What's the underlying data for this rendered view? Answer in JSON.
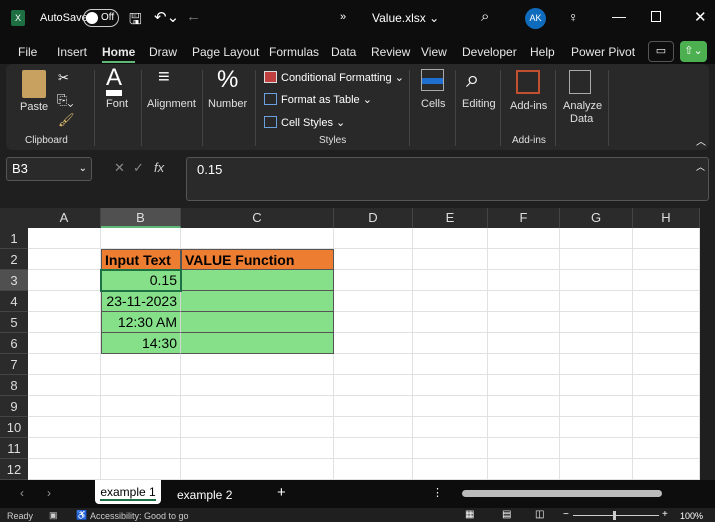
{
  "titlebar": {
    "autosave": "AutoSave",
    "toggle": "Off",
    "filename": "Value.xlsx ⌄",
    "avatar": "AK"
  },
  "menu": [
    "File",
    "Insert",
    "Home",
    "Draw",
    "Page Layout",
    "Formulas",
    "Data",
    "Review",
    "View",
    "Developer",
    "Help",
    "Power Pivot"
  ],
  "ribbon": {
    "paste": "Paste",
    "clipboard": "Clipboard",
    "font": "Font",
    "alignment": "Alignment",
    "number": "Number",
    "cond_format": "Conditional Formatting ⌄",
    "format_table": "Format as Table ⌄",
    "cell_styles": "Cell Styles ⌄",
    "styles": "Styles",
    "cells": "Cells",
    "editing": "Editing",
    "addins": "Add-ins",
    "addins_group": "Add-ins",
    "analyze": "Analyze",
    "analyze2": "Data"
  },
  "formula": {
    "name_box": "B3",
    "fx": "fx",
    "value": "0.15"
  },
  "columns": [
    "A",
    "B",
    "C",
    "D",
    "E",
    "F",
    "G",
    "H"
  ],
  "rows": [
    "1",
    "2",
    "3",
    "4",
    "5",
    "6",
    "7",
    "8",
    "9",
    "10",
    "11",
    "12"
  ],
  "table": {
    "headers": [
      "Input Text",
      "VALUE Function"
    ],
    "values": [
      "0.15",
      "23-11-2023",
      "12:30 AM",
      "14:30"
    ],
    "header_color": "#ed7d31",
    "body_color": "#86e08a"
  },
  "sheets": [
    "example 1",
    "example 2"
  ],
  "status": {
    "ready": "Ready",
    "accessibility": "Accessibility: Good to go",
    "zoom": "100%"
  }
}
